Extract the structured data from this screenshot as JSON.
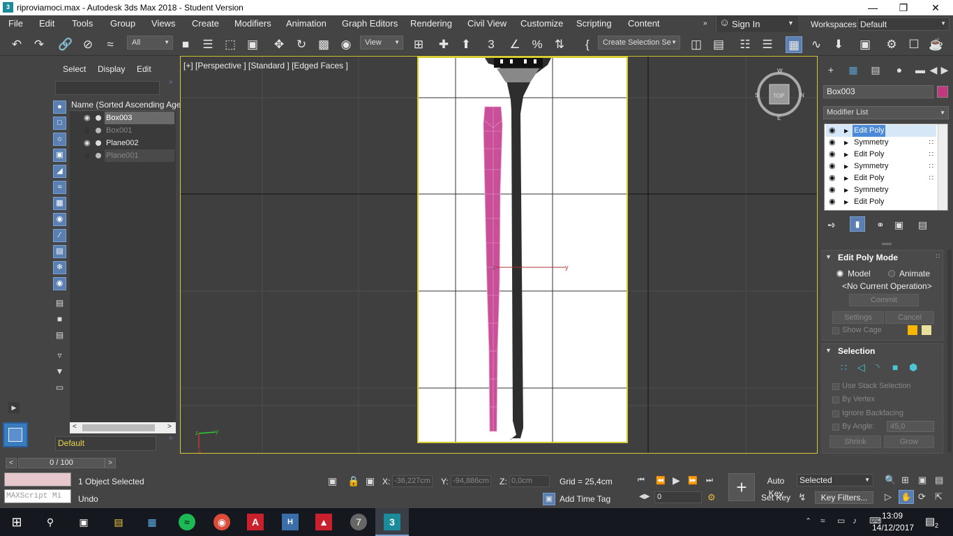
{
  "window": {
    "title": "riproviamoci.max - Autodesk 3ds Max 2018 - Student Version",
    "app_icon": "3ds-max-icon"
  },
  "menu": [
    "File",
    "Edit",
    "Tools",
    "Group",
    "Views",
    "Create",
    "Modifiers",
    "Animation",
    "Graph Editors",
    "Rendering",
    "Civil View",
    "Customize",
    "Scripting",
    "Content"
  ],
  "signin": {
    "label": "Sign In"
  },
  "workspaces": {
    "label": "Workspaces:",
    "value": "Default"
  },
  "toolbar": {
    "filter_value": "All",
    "refcoord_value": "View",
    "selection_set_value": "Create Selection Se"
  },
  "explorer": {
    "tabs": [
      "Select",
      "Display",
      "Edit"
    ],
    "search_value": "",
    "column_header": "Name (Sorted Ascending Age)",
    "items": [
      {
        "name": "Box003",
        "visible": true,
        "selected": true
      },
      {
        "name": "Box001",
        "visible": false,
        "selected": false
      },
      {
        "name": "Plane002",
        "visible": true,
        "selected": false
      },
      {
        "name": "Plane001",
        "visible": false,
        "selected": false
      }
    ],
    "layer": "Default"
  },
  "viewport": {
    "label": "[+] [Perspective ] [Standard ] [Edged Faces ]",
    "gizmo_x": "x",
    "gizmo_y": "y",
    "gizmo_z": "z",
    "viewcube_top": "TOP",
    "viewcube_n": "N",
    "viewcube_s": "S",
    "viewcube_e": "E",
    "viewcube_w": "W"
  },
  "command_panel": {
    "object_name": "Box003",
    "object_color": "#c0397f",
    "modifier_list": "Modifier List",
    "stack": [
      "Edit Poly",
      "Symmetry",
      "Edit Poly",
      "Symmetry",
      "Edit Poly",
      "Symmetry",
      "Edit Poly"
    ],
    "edit_poly_mode": {
      "title": "Edit Poly Mode",
      "model": "Model",
      "animate": "Animate",
      "current_op": "<No Current Operation>",
      "commit": "Commit",
      "settings": "Settings",
      "cancel": "Cancel",
      "show_cage": "Show Cage"
    },
    "selection": {
      "title": "Selection",
      "use_stack": "Use Stack Selection",
      "by_vertex": "By Vertex",
      "ignore_backfacing": "Ignore Backfacing",
      "by_angle": "By Angle:",
      "angle_value": "45,0",
      "shrink": "Shrink",
      "grow": "Grow"
    }
  },
  "timeline": {
    "frame": "0 / 100"
  },
  "status": {
    "maxscript_placeholder": "MAXScript Mi",
    "selected_text": "1 Object Selected",
    "undo_text": "Undo",
    "x_label": "X:",
    "x_value": "-36,227cm",
    "y_label": "Y:",
    "y_value": "-94,886cm",
    "z_label": "Z:",
    "z_value": "0,0cm",
    "grid": "Grid = 25,4cm",
    "add_time_tag": "Add Time Tag",
    "auto_key": "Auto Key",
    "set_key": "Set Key",
    "selected_dropdown": "Selected",
    "key_filters": "Key Filters...",
    "frame_value": "0"
  },
  "taskbar": {
    "time": "13:09",
    "date": "14/12/2017",
    "notifications": "2",
    "apps": [
      "windows-start-icon",
      "search-icon",
      "task-view-icon",
      "file-explorer-icon",
      "store-icon",
      "spotify-icon",
      "chrome-icon",
      "autodesk-icon",
      "houdini-icon",
      "acrobat-icon",
      "app-7-icon",
      "3dsmax-icon"
    ]
  }
}
